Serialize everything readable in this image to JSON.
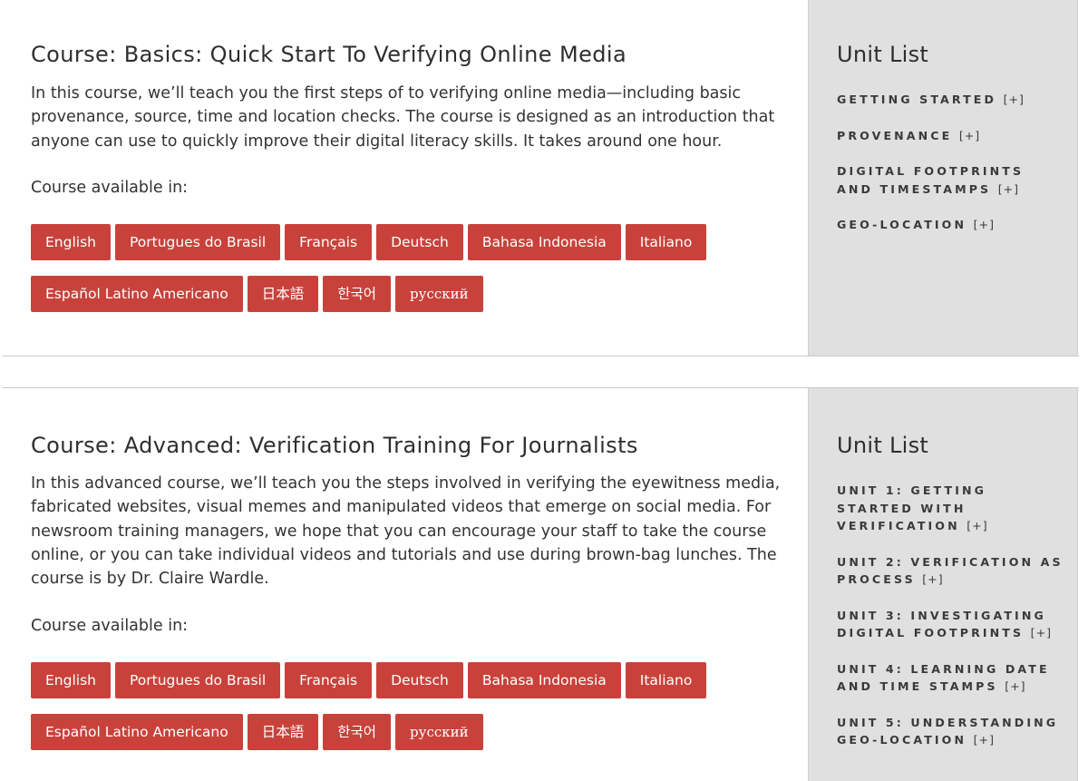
{
  "courses": [
    {
      "title": "Course: Basics: Quick Start To Verifying Online Media",
      "description": "In this course, we’ll teach you the first steps of to verifying online media—including basic provenance, source, time and location checks. The course is designed as an introduction that anyone can use to quickly improve their digital literacy skills. It takes around one hour.",
      "available_label": "Course available in:",
      "languages_row1": [
        "English",
        "Portugues do Brasil",
        "Français",
        "Deutsch",
        "Bahasa Indonesia",
        "Italiano"
      ],
      "languages_row2": [
        "Español Latino Americano",
        "日本語",
        "한국어",
        "русский"
      ],
      "unit_list_title": "Unit List",
      "units": [
        "GETTING STARTED",
        "PROVENANCE",
        "DIGITAL FOOTPRINTS AND TIMESTAMPS",
        "GEO-LOCATION"
      ],
      "expand_marker": "[+]"
    },
    {
      "title": "Course: Advanced: Verification Training For Journalists",
      "description": "In this advanced course, we’ll teach you the steps involved in verifying the eyewitness media, fabricated websites, visual memes and manipulated videos that emerge on social media. For newsroom training managers, we hope that you can encourage your staff to take the course online, or you can take individual videos and tutorials and use during brown-bag lunches. The course is by Dr. Claire Wardle.",
      "available_label": "Course available in:",
      "languages_row1": [
        "English",
        "Portugues do Brasil",
        "Français",
        "Deutsch",
        "Bahasa Indonesia",
        "Italiano"
      ],
      "languages_row2": [
        "Español Latino Americano",
        "日本語",
        "한국어",
        "русский"
      ],
      "unit_list_title": "Unit List",
      "units": [
        "UNIT 1: GETTING STARTED WITH VERIFICATION",
        "UNIT 2: VERIFICATION AS PROCESS",
        "UNIT 3: INVESTIGATING DIGITAL FOOTPRINTS",
        "UNIT 4: LEARNING DATE AND TIME STAMPS",
        "UNIT 5: UNDERSTANDING GEO-LOCATION"
      ],
      "expand_marker": "[+]"
    }
  ],
  "colors": {
    "accent": "#c8423b",
    "sidebar_bg": "#e0e0e0",
    "text": "#333333"
  }
}
